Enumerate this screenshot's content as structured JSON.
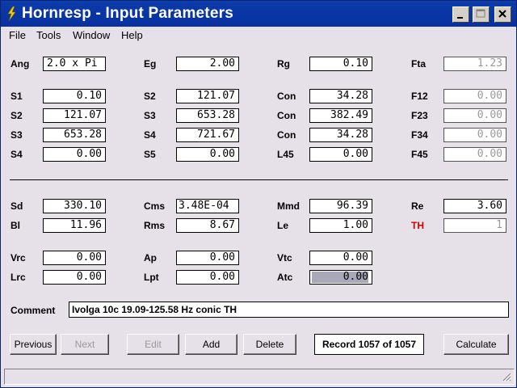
{
  "window": {
    "title": "Hornresp - Input Parameters",
    "icon": "lightning-icon"
  },
  "menu": [
    "File",
    "Tools",
    "Window",
    "Help"
  ],
  "params": {
    "Ang": "2.0 x Pi",
    "Eg": "2.00",
    "Rg": "0.10",
    "Fta": "1.23",
    "S1": "0.10",
    "S2a": "121.07",
    "Con1": "34.28",
    "F12": "0.00",
    "S2b": "121.07",
    "S3a": "653.28",
    "Con2": "382.49",
    "F23": "0.00",
    "S3b": "653.28",
    "S4a": "721.67",
    "Con3": "34.28",
    "F34": "0.00",
    "S4b": "0.00",
    "S5": "0.00",
    "L45": "0.00",
    "F45": "0.00",
    "Sd": "330.10",
    "Cms": "3.48E-04",
    "Mmd": "96.39",
    "Re": "3.60",
    "Bl": "11.96",
    "Rms": "8.67",
    "Le": "1.00",
    "TH": "1",
    "Vrc": "0.00",
    "Ap": "0.00",
    "Vtc": "0.00",
    "Lrc": "0.00",
    "Lpt": "0.00",
    "Atc": "0.00"
  },
  "labels": {
    "Ang": "Ang",
    "Eg": "Eg",
    "Rg": "Rg",
    "Fta": "Fta",
    "S1": "S1",
    "S2": "S2",
    "Con": "Con",
    "F12": "F12",
    "S3": "S3",
    "F23": "F23",
    "S4": "S4",
    "F34": "F34",
    "S5": "S5",
    "L45": "L45",
    "F45": "F45",
    "Sd": "Sd",
    "Cms": "Cms",
    "Mmd": "Mmd",
    "Re": "Re",
    "Bl": "Bl",
    "Rms": "Rms",
    "Le": "Le",
    "TH": "TH",
    "Vrc": "Vrc",
    "Ap": "Ap",
    "Vtc": "Vtc",
    "Lrc": "Lrc",
    "Lpt": "Lpt",
    "Atc": "Atc",
    "Comment": "Comment"
  },
  "comment": "Ivolga 10c 19.09-125.58 Hz conic TH",
  "buttons": {
    "previous": "Previous",
    "next": "Next",
    "edit": "Edit",
    "add": "Add",
    "delete": "Delete",
    "calculate": "Calculate"
  },
  "record": "Record 1057 of 1057",
  "colors": {
    "titlebar": "#0a2a9a",
    "window_bg": "#e6e0e8",
    "th_label": "#d00000"
  }
}
